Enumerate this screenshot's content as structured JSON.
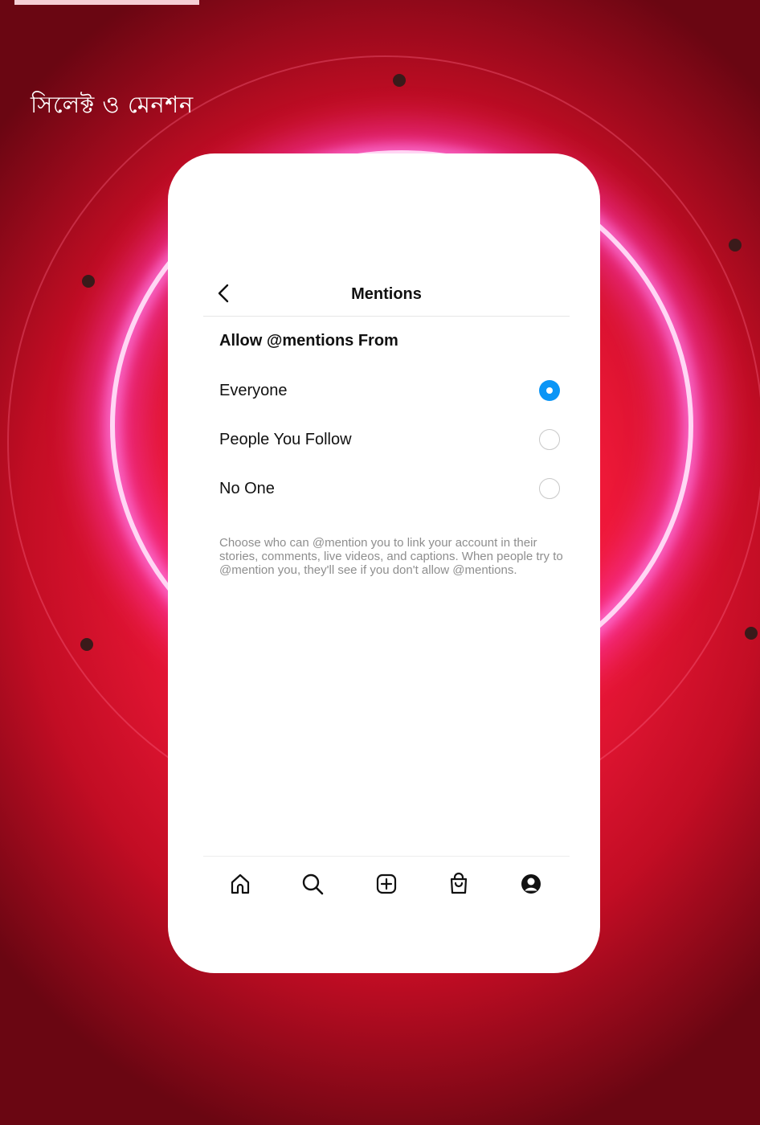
{
  "caption": "সিলেক্ট ও মেনশন",
  "screen": {
    "title": "Mentions",
    "section_heading": "Allow @mentions From",
    "options": [
      {
        "label": "Everyone",
        "selected": true
      },
      {
        "label": "People You Follow",
        "selected": false
      },
      {
        "label": "No One",
        "selected": false
      }
    ],
    "description": "Choose who can @mention you to link your account in their stories, comments, live videos, and captions. When people try to @mention you, they'll see if you don't allow @mentions."
  },
  "tab_bar": [
    "home-icon",
    "search-icon",
    "create-icon",
    "shop-icon",
    "profile-icon"
  ],
  "colors": {
    "accent": "#0a95f6",
    "background_red": "#ee1838",
    "neon_pink": "#ff4fd0"
  }
}
